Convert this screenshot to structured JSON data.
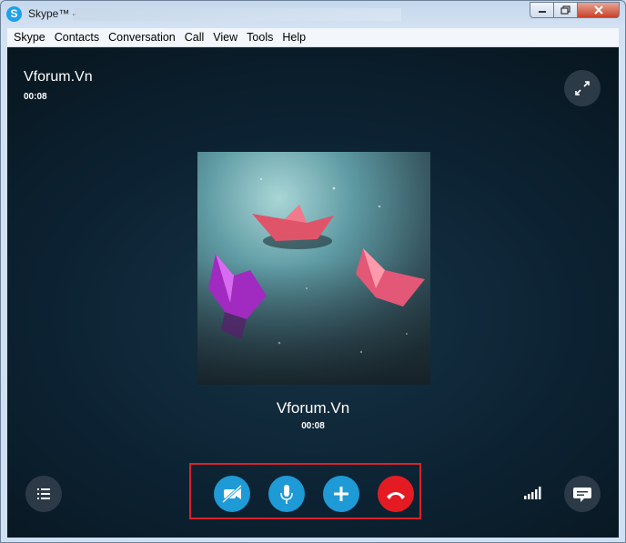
{
  "window": {
    "title": "Skype™ -",
    "icon": "skype-logo-icon"
  },
  "menu": [
    "Skype",
    "Contacts",
    "Conversation",
    "Call",
    "View",
    "Tools",
    "Help"
  ],
  "call": {
    "contact_name": "Vforum.Vn",
    "duration": "00:08"
  },
  "controls": [
    {
      "name": "video-off",
      "icon": "video-off-icon",
      "color": "#1e9ad6"
    },
    {
      "name": "microphone",
      "icon": "microphone-icon",
      "color": "#1e9ad6"
    },
    {
      "name": "add",
      "icon": "plus-icon",
      "color": "#1e9ad6"
    },
    {
      "name": "end-call",
      "icon": "hang-up-icon",
      "color": "#e51b24"
    }
  ],
  "colors": {
    "accent": "#1e9ad6",
    "hangup": "#e51b24",
    "highlight_frame": "#d8232a",
    "call_background": "#0c2232"
  }
}
